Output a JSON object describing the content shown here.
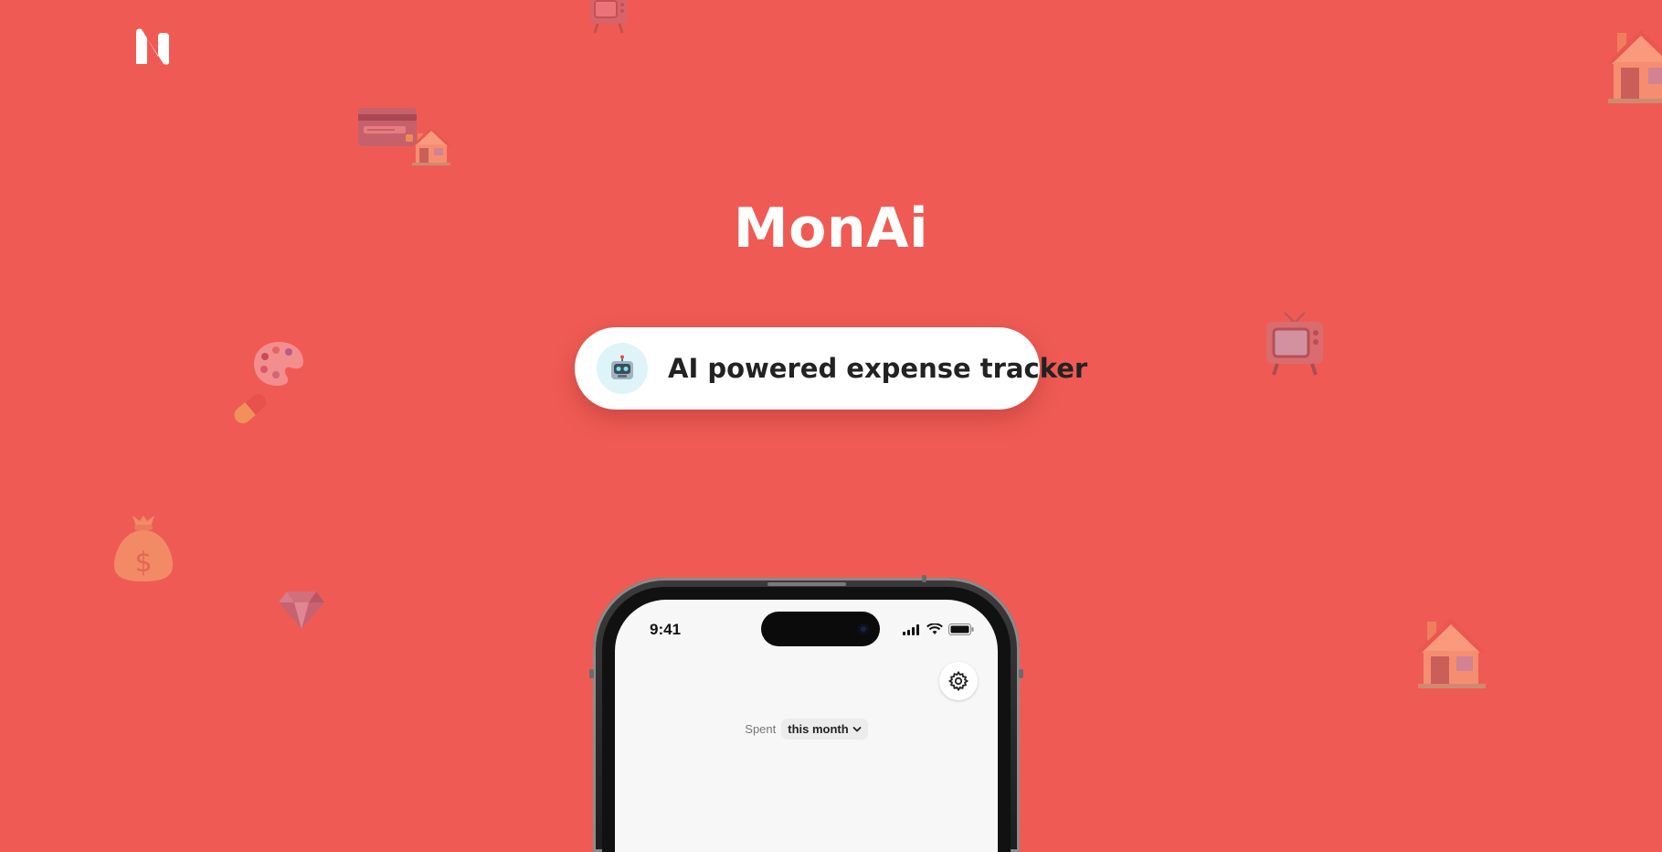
{
  "brand": {
    "logo_icon": "monai-logo-icon",
    "app_name": "MonAi"
  },
  "tagline": {
    "icon": "robot-emoji-icon",
    "text": "AI powered expense tracker"
  },
  "background_icons": [
    "tv-icon",
    "credit-card-icon",
    "house-icon",
    "palette-icon",
    "pill-icon",
    "money-bag-icon",
    "gem-icon"
  ],
  "phone": {
    "status_bar": {
      "time": "9:41",
      "icons": [
        "signal-icon",
        "wifi-icon",
        "battery-icon"
      ]
    },
    "settings_icon": "gear-icon",
    "spent_label": "Spent",
    "period_selector": {
      "value": "this month",
      "icon": "chevron-down-icon"
    }
  },
  "colors": {
    "background": "#ef5b54",
    "pill_background": "#ffffff",
    "robot_badge": "#dff4f8"
  }
}
